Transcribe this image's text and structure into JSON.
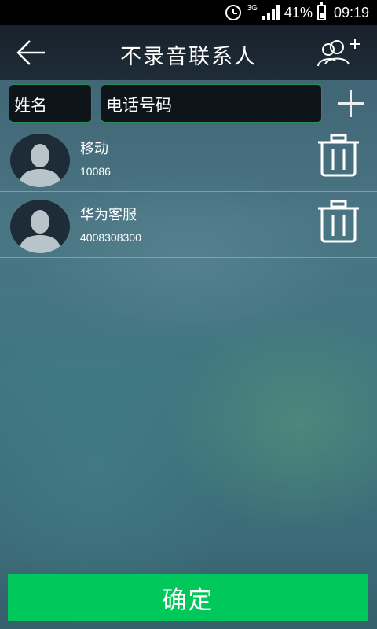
{
  "status_bar": {
    "network": "3G",
    "battery_percent": "41%",
    "battery_level": 0.41,
    "time": "09:19",
    "icons": [
      "alarm-clock-icon",
      "signal-icon",
      "battery-icon"
    ]
  },
  "header": {
    "title": "不录音联系人",
    "back_icon": "arrow-left-icon",
    "add_icon": "add-contact-icon"
  },
  "inputs": {
    "name_placeholder": "姓名",
    "phone_placeholder": "电话号码",
    "add_icon": "plus-icon"
  },
  "contacts": [
    {
      "name": "移动",
      "phone": "10086"
    },
    {
      "name": "华为客服",
      "phone": "4008308300"
    }
  ],
  "footer": {
    "confirm_label": "确定"
  },
  "colors": {
    "accent_green": "#00c85a",
    "input_border": "#2b8d55",
    "titlebar": "#1a2530"
  }
}
